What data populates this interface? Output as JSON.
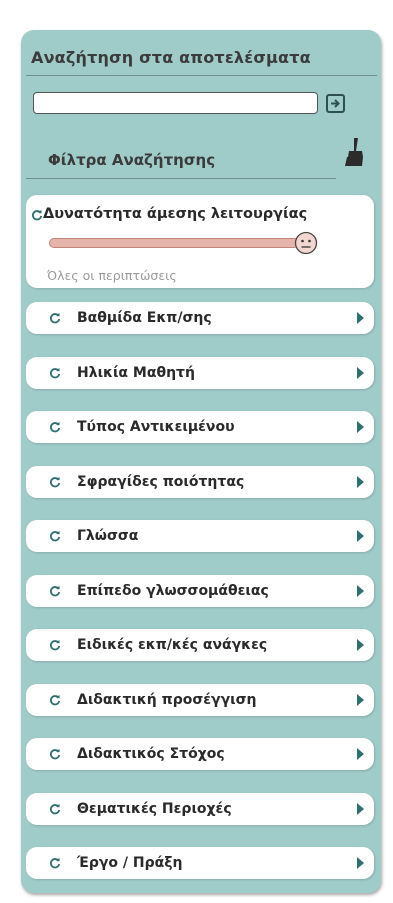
{
  "panel": {
    "title": "Αναζήτηση στα αποτελέσματα",
    "search": {
      "value": "",
      "placeholder": ""
    },
    "filters_title": "Φίλτρα Αναζήτησης"
  },
  "availability": {
    "title": "Δυνατότητα άμεσης λειτουργίας",
    "subtitle": "Όλες οι περιπτώσεις"
  },
  "filters": [
    {
      "label": "Βαθμίδα Εκπ/σης"
    },
    {
      "label": "Ηλικία Μαθητή"
    },
    {
      "label": "Τύπος Αντικειμένου"
    },
    {
      "label": "Σφραγίδες ποιότητας"
    },
    {
      "label": "Γλώσσα"
    },
    {
      "label": "Επίπεδο γλωσσομάθειας"
    },
    {
      "label": "Ειδικές εκπ/κές ανάγκες"
    },
    {
      "label": "Διδακτική προσέγγιση"
    },
    {
      "label": "Διδακτικός Στόχος"
    },
    {
      "label": "Θεματικές Περιοχές"
    },
    {
      "label": "Έργο / Πράξη"
    }
  ],
  "colors": {
    "panel_bg": "#9fcbc9",
    "slider_fill": "#e6b4ab",
    "icon_teal": "#2f6f6f"
  }
}
